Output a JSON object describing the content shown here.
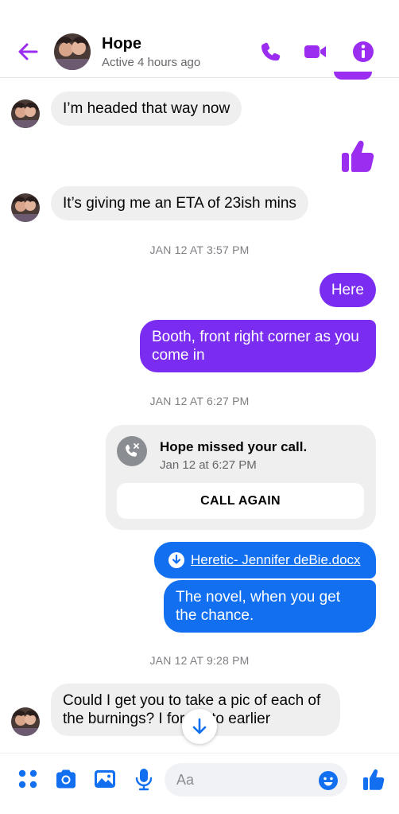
{
  "header": {
    "name": "Hope",
    "status": "Active 4 hours ago"
  },
  "messages": {
    "m1": "I’m headed that way now",
    "m2": "It’s giving me an ETA of 23ish mins",
    "ts1": "JAN 12 AT 3:57 PM",
    "m3": "Here",
    "m4": "Booth, front right corner as you come in",
    "ts2": "JAN 12 AT 6:27 PM",
    "call": {
      "title": "Hope missed your call.",
      "time": "Jan 12 at 6:27 PM",
      "button": "CALL AGAIN"
    },
    "file": "Heretic- Jennifer deBie.docx",
    "m5": "The novel, when you get the chance.",
    "ts3": "JAN 12 AT 9:28 PM",
    "m6_line1": "Could I get you to take a pic of each of",
    "m6_line2a": "the burnings? I for",
    "m6_line2b": "to earlier"
  },
  "composer": {
    "placeholder": "Aa"
  },
  "colors": {
    "accent_purple": "#9b2df1",
    "bubble_purple": "#7a2cf0",
    "bubble_blue": "#1270f0",
    "incoming": "#efefef"
  },
  "icons": {
    "back": "arrow-left-icon",
    "phone": "phone-icon",
    "video": "video-camera-icon",
    "info": "info-icon",
    "thumb": "thumbs-up-icon",
    "missed_call": "missed-call-icon",
    "download": "download-icon",
    "scroll": "arrow-down-icon",
    "menu": "four-dots-icon",
    "camera": "camera-icon",
    "gallery": "image-icon",
    "mic": "microphone-icon",
    "emoji": "smiley-icon"
  }
}
